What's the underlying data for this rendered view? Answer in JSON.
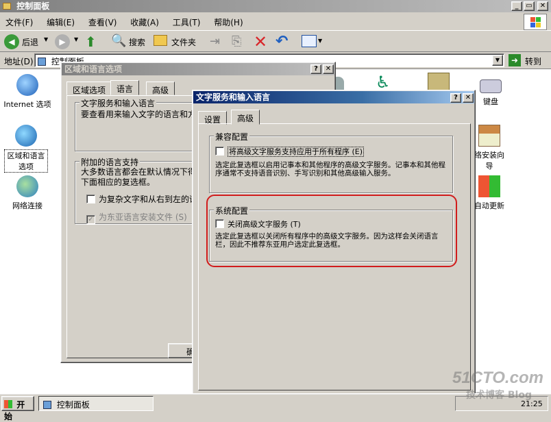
{
  "explorer": {
    "title": "控制面板",
    "menu": [
      "文件(F)",
      "编辑(E)",
      "查看(V)",
      "收藏(A)",
      "工具(T)",
      "帮助(H)"
    ],
    "toolbar": {
      "back": "后退",
      "search": "搜索",
      "folders": "文件夹"
    },
    "address_label": "地址(D)",
    "address_value": "控制面板",
    "go_label": "转到"
  },
  "icons": [
    {
      "label": "Internet 选项"
    },
    {
      "label": "区域和语言选项"
    },
    {
      "label": "网络连接"
    },
    {
      "label": "键盘"
    },
    {
      "label": "络安装向导"
    },
    {
      "label": "自动更新"
    }
  ],
  "region_dialog": {
    "title": "区域和语言选项",
    "tabs": [
      "区域选项",
      "语言",
      "高级"
    ],
    "group1_title": "文字服务和输入语言",
    "group1_text": "要查看用来输入文字的语言和方",
    "group2_title": "附加的语言支持",
    "group2_text": "大多数语言都会在默认情况下得\n下面相应的复选框。",
    "chk1": "为复杂文字和从右到左的语",
    "chk2": "为东亚语言安装文件 (S)",
    "ok_partial": "确"
  },
  "text_dialog": {
    "title": "文字服务和输入语言",
    "tabs": [
      "设置",
      "高级"
    ],
    "compat_title": "兼容配置",
    "compat_check": "将高级文字服务支持应用于所有程序 (E)",
    "compat_desc": "选定此复选框以启用记事本和其他程序的高级文字服务。记事本和其他程序通常不支持语音识别、手写识别和其他高级输入服务。",
    "sys_title": "系统配置",
    "sys_check": "关闭高级文字服务 (T)",
    "sys_desc": "选定此复选框以关闭所有程序中的高级文字服务。因为这样会关闭语言栏，因此不推荐东亚用户选定此复选框。"
  },
  "taskbar": {
    "start": "开始",
    "task": "控制面板",
    "clock": "21:25"
  },
  "watermark": {
    "line1": "51CTO.com",
    "line2": "技术博客 Blog"
  },
  "colors": {
    "title_active": "#0a246a",
    "highlight_ring": "#d11c1c"
  }
}
